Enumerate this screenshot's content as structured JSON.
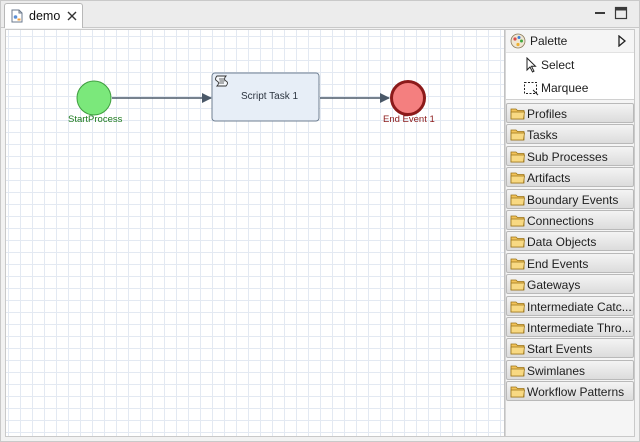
{
  "tab": {
    "title": "demo"
  },
  "canvas": {
    "start_label": "StartProcess",
    "task_label": "Script Task 1",
    "end_label": "End Event 1"
  },
  "palette": {
    "title": "Palette",
    "tools": [
      "Select",
      "Marquee"
    ],
    "drawers": [
      "Profiles",
      "Tasks",
      "Sub Processes",
      "Artifacts",
      "Boundary Events",
      "Connections",
      "Data Objects",
      "End Events",
      "Gateways",
      "Intermediate Catc...",
      "Intermediate Thro...",
      "Start Events",
      "Swimlanes",
      "Workflow Patterns"
    ]
  },
  "colors": {
    "start_fill": "#7be87b",
    "end_fill": "#f47f7f",
    "end_stroke": "#8c1a1a",
    "task_fill": "#e7eef7",
    "connector": "#4a5868",
    "drawer_folder": "#f2c35a"
  }
}
